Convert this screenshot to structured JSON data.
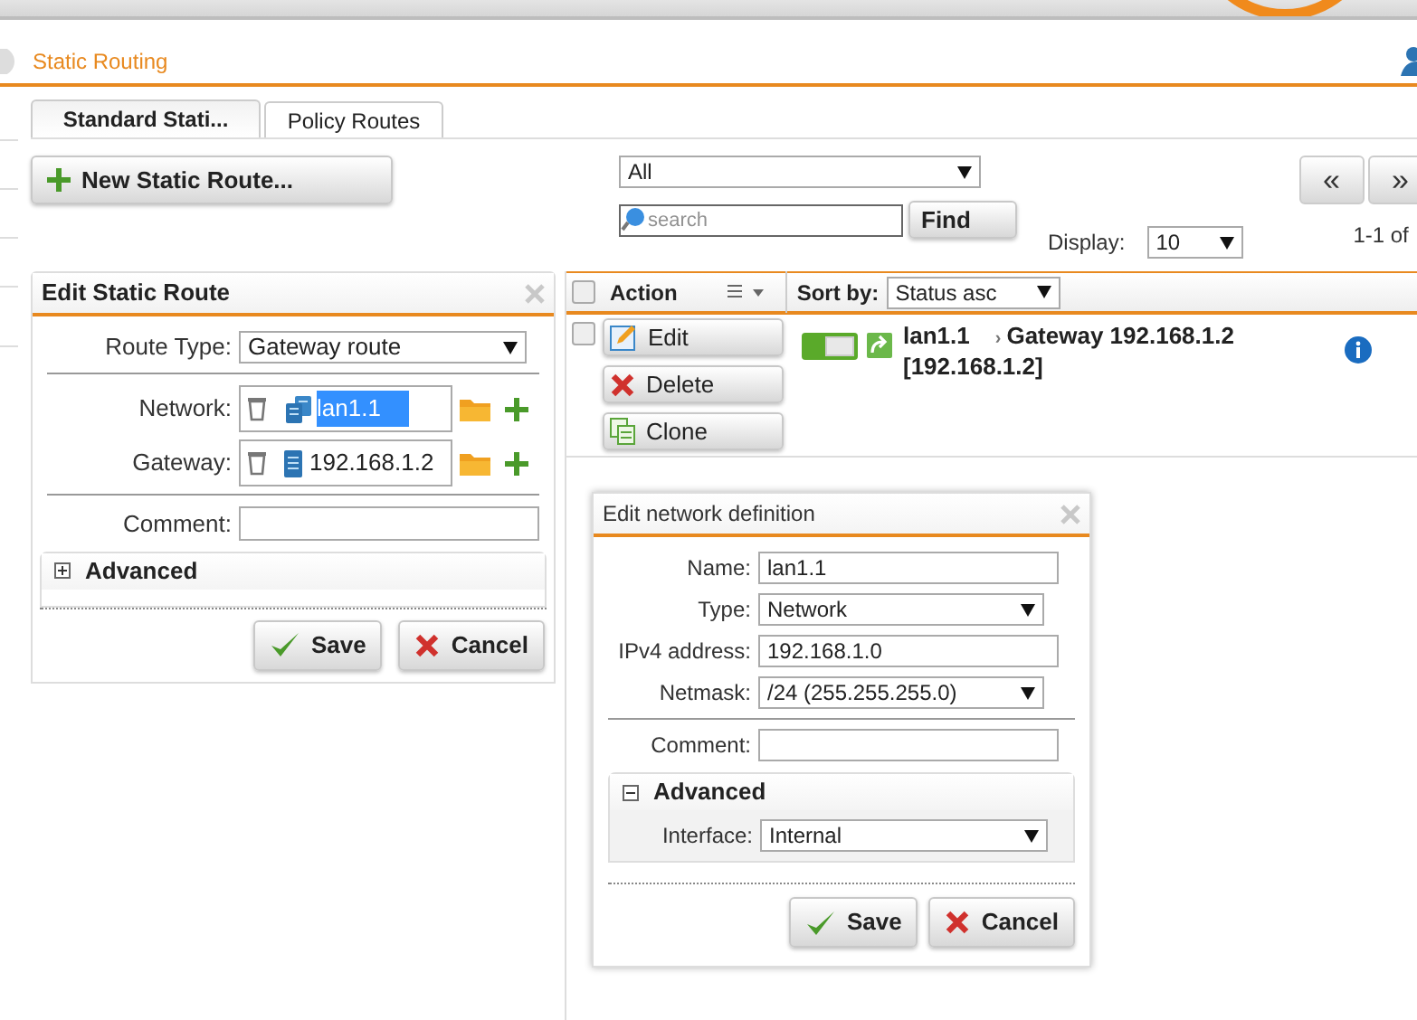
{
  "header": {
    "title": "Static Routing"
  },
  "tabs": [
    {
      "label": "Standard Stati...",
      "selected": true
    },
    {
      "label": "Policy Routes",
      "selected": false
    }
  ],
  "new_button": "New Static Route...",
  "filter": {
    "value": "All"
  },
  "search": {
    "placeholder": "search",
    "button": "Find"
  },
  "display": {
    "label": "Display:",
    "value": "10"
  },
  "pager": {
    "prev": "«",
    "next": "»",
    "range": "1-1 of"
  },
  "edit_route": {
    "title": "Edit Static Route",
    "route_type": {
      "label": "Route Type:",
      "value": "Gateway route"
    },
    "objects": [
      {
        "label": "Network:",
        "value": "lan1.1",
        "kind": "network",
        "highlighted": true
      },
      {
        "label": "Gateway:",
        "value": "192.168.1.2",
        "kind": "host",
        "highlighted": false
      }
    ],
    "comment": {
      "label": "Comment:"
    },
    "advanced": {
      "label": "Advanced",
      "expanded": false
    },
    "buttons": [
      {
        "label": "Save",
        "kind": "save"
      },
      {
        "label": "Cancel",
        "kind": "cancel"
      }
    ]
  },
  "list": {
    "all_checked": false,
    "action_label": "Action",
    "sort_label": "Sort by:",
    "sort_value": "Status asc",
    "rows": [
      {
        "checked": false,
        "enabled": true,
        "name": "lan1.1",
        "arrow": "›",
        "target": "Gateway 192.168.1.2",
        "detail": "[192.168.1.2]",
        "actions": [
          {
            "label": "Edit",
            "kind": "edit"
          },
          {
            "label": "Delete",
            "kind": "delete"
          },
          {
            "label": "Clone",
            "kind": "clone"
          }
        ]
      }
    ]
  },
  "network_dialog": {
    "title": "Edit network definition",
    "fields": [
      {
        "label": "Name:",
        "value": "lan1.1",
        "kind": "input"
      },
      {
        "label": "Type:",
        "value": "Network",
        "kind": "select"
      },
      {
        "label": "IPv4 address:",
        "value": "192.168.1.0",
        "kind": "input"
      },
      {
        "label": "Netmask:",
        "value": "/24 (255.255.255.0)",
        "kind": "select"
      }
    ],
    "comment": {
      "label": "Comment:"
    },
    "advanced": {
      "label": "Advanced",
      "expanded": true,
      "fields": [
        {
          "label": "Interface:",
          "value": "Internal",
          "kind": "select"
        }
      ]
    },
    "buttons": [
      {
        "label": "Save",
        "kind": "save"
      },
      {
        "label": "Cancel",
        "kind": "cancel"
      }
    ]
  }
}
